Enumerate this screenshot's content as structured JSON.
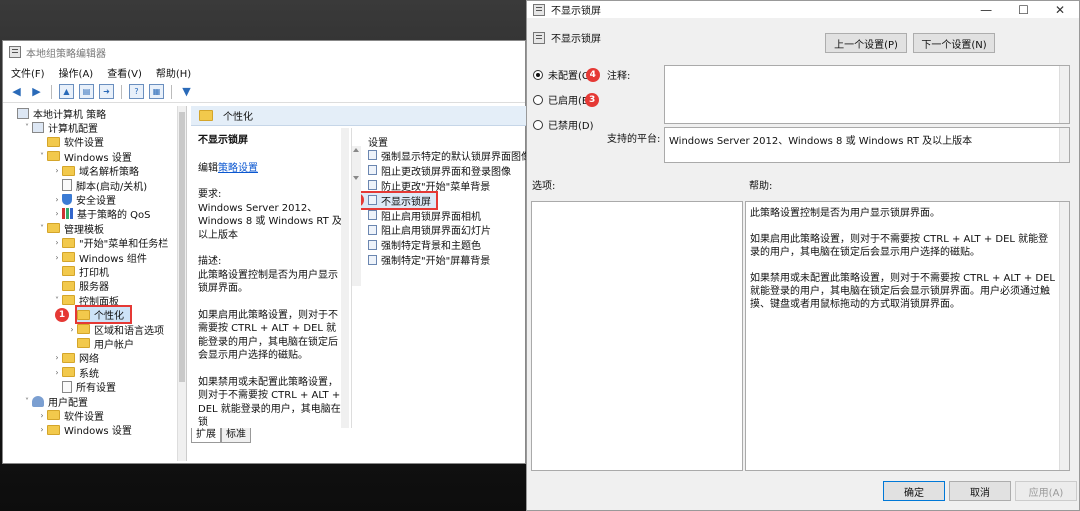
{
  "editor": {
    "title": "本地组策略编辑器",
    "menu": [
      "文件(F)",
      "操作(A)",
      "查看(V)",
      "帮助(H)"
    ],
    "tree": [
      {
        "label": "本地计算机 策略",
        "level": 0,
        "icon": "computer-icon",
        "chev": ""
      },
      {
        "label": "计算机配置",
        "level": 1,
        "icon": "computer-icon",
        "chev": "˅"
      },
      {
        "label": "软件设置",
        "level": 2,
        "icon": "folder-icon",
        "chev": ""
      },
      {
        "label": "Windows 设置",
        "level": 2,
        "icon": "folder-icon",
        "chev": "˅"
      },
      {
        "label": "域名解析策略",
        "level": 3,
        "icon": "folder-icon",
        "chev": "›"
      },
      {
        "label": "脚本(启动/关机)",
        "level": 3,
        "icon": "doc-icon",
        "chev": ""
      },
      {
        "label": "安全设置",
        "level": 3,
        "icon": "shield-icon",
        "chev": "›"
      },
      {
        "label": "基于策略的 QoS",
        "level": 3,
        "icon": "chart-icon",
        "chev": "›"
      },
      {
        "label": "管理模板",
        "level": 2,
        "icon": "folder-icon",
        "chev": "˅"
      },
      {
        "label": "\"开始\"菜单和任务栏",
        "level": 3,
        "icon": "folder-icon",
        "chev": "›"
      },
      {
        "label": "Windows 组件",
        "level": 3,
        "icon": "folder-icon",
        "chev": "›"
      },
      {
        "label": "打印机",
        "level": 3,
        "icon": "folder-icon",
        "chev": ""
      },
      {
        "label": "服务器",
        "level": 3,
        "icon": "folder-icon",
        "chev": ""
      },
      {
        "label": "控制面板",
        "level": 3,
        "icon": "folder-icon",
        "chev": "˅"
      },
      {
        "label": "个性化",
        "level": 4,
        "icon": "folder-icon",
        "chev": "",
        "selected": true,
        "marker": "1"
      },
      {
        "label": "区域和语言选项",
        "level": 4,
        "icon": "folder-icon",
        "chev": "›"
      },
      {
        "label": "用户帐户",
        "level": 4,
        "icon": "folder-icon",
        "chev": ""
      },
      {
        "label": "网络",
        "level": 3,
        "icon": "folder-icon",
        "chev": "›"
      },
      {
        "label": "系统",
        "level": 3,
        "icon": "folder-icon",
        "chev": "›"
      },
      {
        "label": "所有设置",
        "level": 3,
        "icon": "doc-icon",
        "chev": ""
      },
      {
        "label": "用户配置",
        "level": 1,
        "icon": "user-icon",
        "chev": "˅"
      },
      {
        "label": "软件设置",
        "level": 2,
        "icon": "folder-icon",
        "chev": "›"
      },
      {
        "label": "Windows 设置",
        "level": 2,
        "icon": "folder-icon",
        "chev": "›"
      }
    ],
    "panel_header": "个性化",
    "desc": {
      "title": "不显示锁屏",
      "edit_prefix": "编辑",
      "edit_link": "策略设置",
      "requirements_label": "要求:",
      "requirements": "Windows Server 2012、Windows 8 或 Windows RT 及以上版本",
      "description_label": "描述:",
      "description": "此策略设置控制是否为用户显示锁屏界面。",
      "p_enabled": "如果启用此策略设置，则对于不需要按 CTRL + ALT + DEL 就能登录的用户，其电脑在锁定后会显示用户选择的磁贴。",
      "p_disabled": "如果禁用或未配置此策略设置，则对于不需要按 CTRL + ALT + DEL 就能登录的用户，其电脑在锁"
    },
    "list_header": "设置",
    "settings": [
      {
        "label": "强制显示特定的默认锁屏界面图像和"
      },
      {
        "label": "阻止更改锁屏界面和登录图像"
      },
      {
        "label": "防止更改\"开始\"菜单背景"
      },
      {
        "label": "不显示锁屏",
        "selected": true,
        "marker": "2"
      },
      {
        "label": "阻止启用锁屏界面相机"
      },
      {
        "label": "阻止启用锁屏界面幻灯片"
      },
      {
        "label": "强制特定背景和主题色"
      },
      {
        "label": "强制特定\"开始\"屏幕背景"
      }
    ],
    "tabs": [
      "扩展",
      "标准"
    ]
  },
  "dialog": {
    "title": "不显示锁屏",
    "name": "不显示锁屏",
    "prev_button": "上一个设置(P)",
    "next_button": "下一个设置(N)",
    "radios": [
      {
        "label": "未配置(C)",
        "checked": true,
        "marker": "4"
      },
      {
        "label": "已启用(E)",
        "checked": false,
        "marker": "3"
      },
      {
        "label": "已禁用(D)",
        "checked": false,
        "marker": ""
      }
    ],
    "comment_label": "注释:",
    "platform_label": "支持的平台:",
    "platform_value": "Windows Server 2012、Windows 8 或 Windows RT 及以上版本",
    "options_label": "选项:",
    "help_label": "帮助:",
    "help": [
      "此策略设置控制是否为用户显示锁屏界面。",
      "如果启用此策略设置，则对于不需要按 CTRL + ALT + DEL 就能登录的用户，其电脑在锁定后会显示用户选择的磁贴。",
      "如果禁用或未配置此策略设置，则对于不需要按 CTRL + ALT + DEL 就能登录的用户，其电脑在锁定后会显示锁屏界面。用户必须通过触摸、键盘或者用鼠标拖动的方式取消锁屏界面。"
    ],
    "ok_button": "确定",
    "cancel_button": "取消",
    "apply_button": "应用(A)"
  },
  "colors": {
    "marker": "#e53935",
    "accent": "#0078d7",
    "header_bg": "#e4eef8"
  }
}
